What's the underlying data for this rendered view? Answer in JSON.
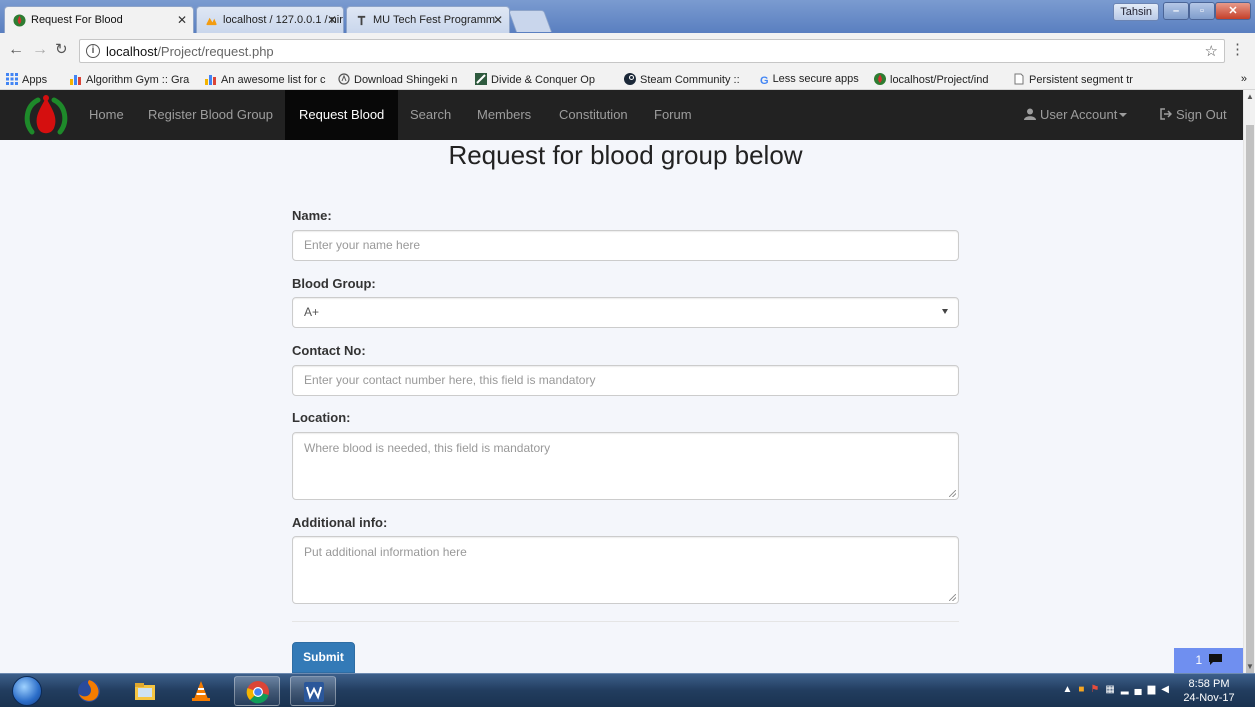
{
  "browser": {
    "tabs": [
      {
        "title": "Request For Blood"
      },
      {
        "title": "localhost / 127.0.0.1 / nir"
      },
      {
        "title": "MU Tech Fest Programm"
      }
    ],
    "profile_name": "Tahsin",
    "url_host": "localhost",
    "url_path": "/Project/request.php",
    "bookmarks": [
      {
        "label": "Apps"
      },
      {
        "label": "Algorithm Gym :: Gra"
      },
      {
        "label": "An awesome list for c"
      },
      {
        "label": "Download Shingeki n"
      },
      {
        "label": "Divide & Conquer Op"
      },
      {
        "label": "Steam Community ::"
      },
      {
        "label": "Less secure apps"
      },
      {
        "label": "localhost/Project/ind"
      },
      {
        "label": "Persistent segment tr"
      }
    ],
    "bookmarks_more": "»"
  },
  "site_nav": {
    "items": [
      {
        "label": "Home"
      },
      {
        "label": "Register Blood Group"
      },
      {
        "label": "Request Blood"
      },
      {
        "label": "Search"
      },
      {
        "label": "Members"
      },
      {
        "label": "Constitution"
      },
      {
        "label": "Forum"
      }
    ],
    "active": "Request Blood",
    "account_label": "User Account",
    "signout_label": "Sign Out"
  },
  "form": {
    "title": "Request for blood group below",
    "name_label": "Name:",
    "name_placeholder": "Enter your name here",
    "blood_label": "Blood Group:",
    "blood_value": "A+",
    "contact_label": "Contact No:",
    "contact_placeholder": "Enter your contact number here, this field is mandatory",
    "location_label": "Location:",
    "location_placeholder": "Where blood is needed, this field is mandatory",
    "info_label": "Additional info:",
    "info_placeholder": "Put additional information here",
    "submit_label": "Submit"
  },
  "chat_widget": {
    "count": "1"
  },
  "taskbar": {
    "time": "8:58 PM",
    "date": "24-Nov-17"
  },
  "colors": {
    "navbar": "#222222",
    "primary": "#337ab7",
    "page_bg": "#f4f6fb"
  }
}
